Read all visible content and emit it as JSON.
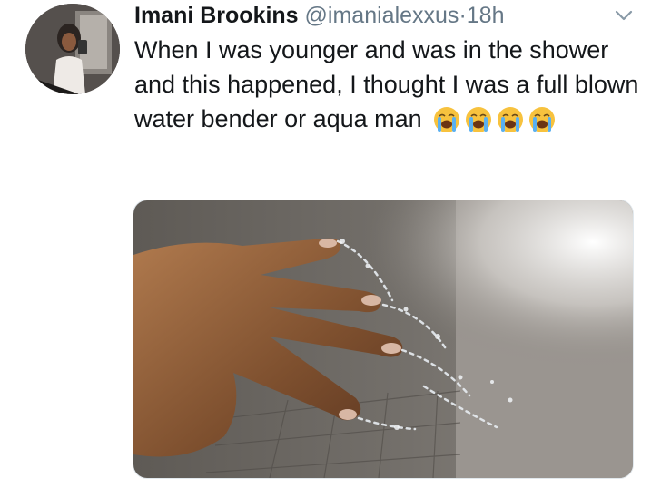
{
  "tweet": {
    "author_name": "Imani Brookins",
    "handle": "@imanialexxus",
    "separator": "·",
    "time": "18h",
    "text": "When I was younger and was in the shower and this happened, I thought I was a full blown water bender or aqua man",
    "emojis": [
      "loudly-crying-face",
      "loudly-crying-face",
      "loudly-crying-face",
      "loudly-crying-face"
    ]
  },
  "icons": {
    "more": "chevron-down-icon"
  },
  "colors": {
    "text": "#14171a",
    "secondary": "#657786",
    "emoji_face": "#f7c23e"
  }
}
